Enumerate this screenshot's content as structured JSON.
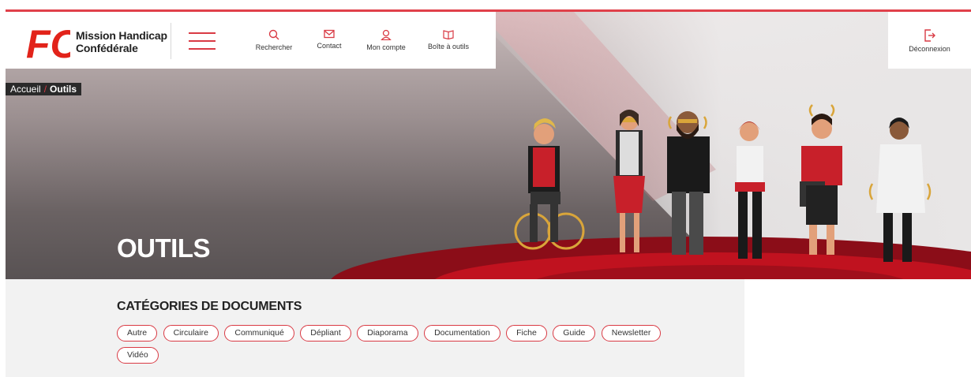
{
  "brand": {
    "logo_text": "FO",
    "line1": "Mission Handicap",
    "line2": "Confédérale"
  },
  "nav": {
    "search": "Rechercher",
    "contact": "Contact",
    "account": "Mon compte",
    "toolbox": "Boîte à outils",
    "logout": "Déconnexion"
  },
  "breadcrumb": {
    "home": "Accueil",
    "separator": "/",
    "current": "Outils"
  },
  "hero": {
    "title": "OUTILS"
  },
  "categories": {
    "title": "CATÉGORIES DE DOCUMENTS",
    "items": [
      "Autre",
      "Circulaire",
      "Communiqué",
      "Dépliant",
      "Diaporama",
      "Documentation",
      "Fiche",
      "Guide",
      "Newsletter",
      "Vidéo"
    ]
  },
  "colors": {
    "accent": "#d93a44",
    "dark": "#2a2a2a",
    "panel": "#f2f2f2"
  }
}
